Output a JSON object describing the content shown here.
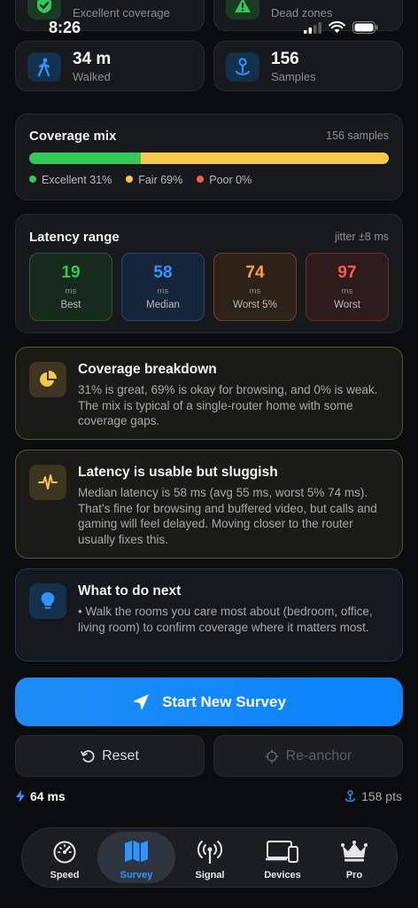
{
  "status_bar": {
    "time": "8:26"
  },
  "top_partial": {
    "left_label": "Excellent coverage",
    "right_label": "Dead zones"
  },
  "stats": {
    "walked": {
      "value": "34 m",
      "label": "Walked"
    },
    "samples": {
      "value": "156",
      "label": "Samples"
    }
  },
  "coverage_mix": {
    "title": "Coverage mix",
    "meta": "156 samples",
    "bar": {
      "excellent_fraction": 0.31,
      "fair_fraction": 0.69,
      "poor_fraction": 0.0
    },
    "legend": [
      {
        "text": "Excellent 31%",
        "color": "#34c759"
      },
      {
        "text": "Fair 69%",
        "color": "#f7c948"
      },
      {
        "text": "Poor 0%",
        "color": "#ff5a4f"
      }
    ]
  },
  "latency": {
    "title": "Latency range",
    "meta": "jitter ±8 ms",
    "tiles": [
      {
        "value": "19",
        "unit": "ms",
        "label": "Best",
        "color": "#34c759"
      },
      {
        "value": "58",
        "unit": "ms",
        "label": "Median",
        "color": "#2e95ff"
      },
      {
        "value": "74",
        "unit": "ms",
        "label": "Worst 5%",
        "color": "#ff9f43"
      },
      {
        "value": "97",
        "unit": "ms",
        "label": "Worst",
        "color": "#ff5a4f"
      }
    ]
  },
  "insights": [
    {
      "title": "Coverage breakdown",
      "body": "31% is great, 69% is okay for browsing, and 0% is weak. The mix is typical of a single-router home with some coverage gaps.",
      "icon": "pie-chart-icon"
    },
    {
      "title": "Latency is usable but sluggish",
      "body": "Median latency is 58 ms (avg 55 ms, worst 5% 74 ms). That's fine for browsing and buffered video, but calls and gaming will feel delayed. Moving closer to the router usually fixes this.",
      "icon": "waveform-icon"
    },
    {
      "title": "What to do next",
      "body": "• Walk the rooms you care most about (bedroom, office, living room) to confirm coverage where it matters most.",
      "icon": "lightbulb-icon"
    }
  ],
  "actions": {
    "start": "Start New Survey",
    "reset": "Reset",
    "reanchor": "Re-anchor"
  },
  "footer": {
    "latency": "64 ms",
    "points": "158 pts"
  },
  "tabs": [
    {
      "label": "Speed",
      "icon": "speedometer-icon"
    },
    {
      "label": "Survey",
      "icon": "map-icon"
    },
    {
      "label": "Signal",
      "icon": "antenna-icon"
    },
    {
      "label": "Devices",
      "icon": "devices-icon"
    },
    {
      "label": "Pro",
      "icon": "crown-icon"
    }
  ]
}
